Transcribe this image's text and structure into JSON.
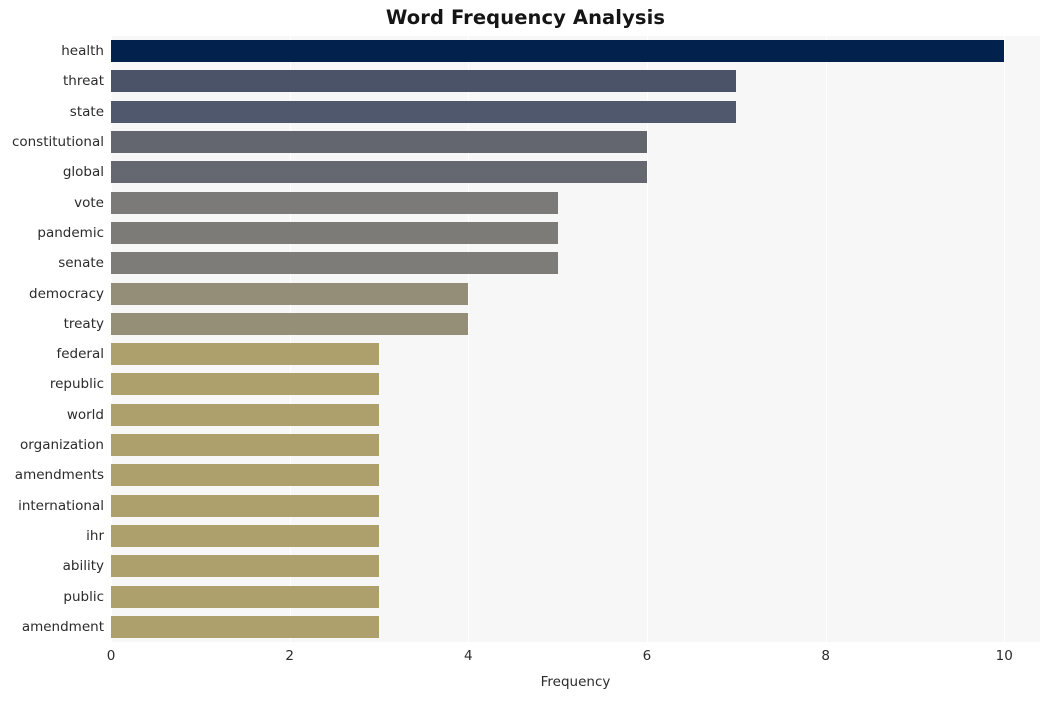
{
  "chart_data": {
    "type": "bar",
    "orientation": "horizontal",
    "title": "Word Frequency Analysis",
    "xlabel": "Frequency",
    "ylabel": "",
    "xlim": [
      0,
      10.4
    ],
    "ylim": [
      0,
      20
    ],
    "xticks": [
      0,
      2,
      4,
      6,
      8,
      10
    ],
    "xtick_labels": [
      "0",
      "2",
      "4",
      "6",
      "8",
      "10"
    ],
    "grid": true,
    "grid_axis": "x",
    "legend": null,
    "categories": [
      "health",
      "threat",
      "state",
      "constitutional",
      "global",
      "vote",
      "pandemic",
      "senate",
      "democracy",
      "treaty",
      "federal",
      "republic",
      "world",
      "organization",
      "amendments",
      "international",
      "ihr",
      "ability",
      "public",
      "amendment"
    ],
    "values": [
      10,
      7,
      7,
      6,
      6,
      5,
      5,
      5,
      4,
      4,
      3,
      3,
      3,
      3,
      3,
      3,
      3,
      3,
      3,
      3
    ],
    "bar_colors": [
      "#02224d",
      "#4b5369",
      "#50586e",
      "#64666f",
      "#666871",
      "#7b7a78",
      "#7c7b78",
      "#7e7c78",
      "#948d78",
      "#968f77",
      "#aea06c",
      "#aea06c",
      "#aea06c",
      "#aea06c",
      "#aea06c",
      "#aea06c",
      "#aea06c",
      "#aea06c",
      "#aea06c",
      "#aea06c"
    ],
    "plot_background": "#f7f7f7",
    "figure_background": "#ffffff",
    "gridline_color": "#ffffff",
    "text_color": "#2b2b2b",
    "title_color": "#151515"
  }
}
